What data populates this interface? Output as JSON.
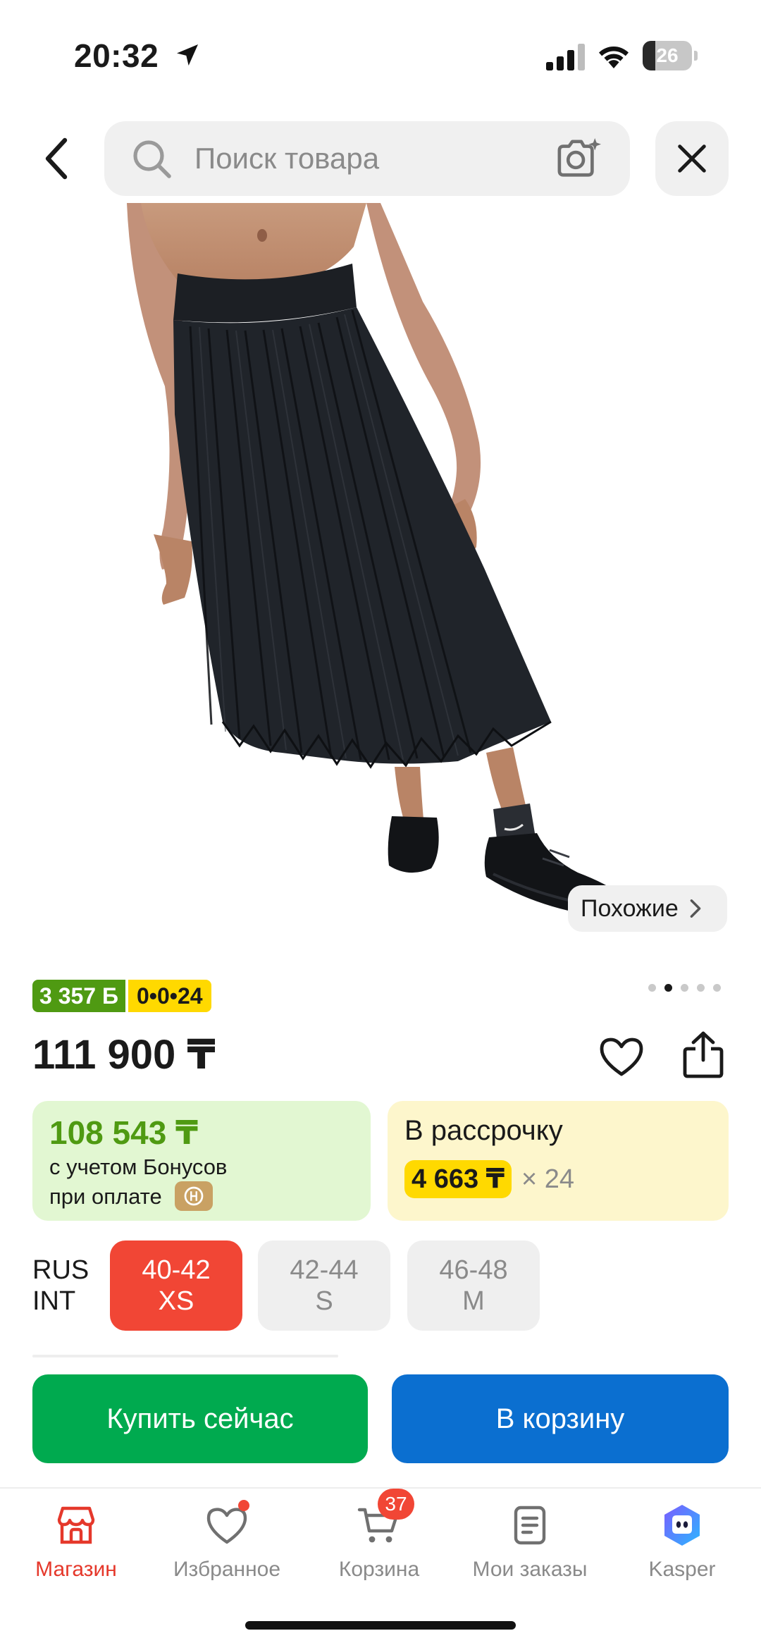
{
  "status_bar": {
    "time": "20:32",
    "battery": "26",
    "battery_level": 0.26
  },
  "search": {
    "placeholder": "Поиск товара"
  },
  "gallery": {
    "similar_label": "Похожие",
    "slide_count": 5,
    "active_slide": 2
  },
  "badges": {
    "bonus": "3 357 Б",
    "installment": "0•0•24"
  },
  "product": {
    "price": "111 900 ₸"
  },
  "offers": {
    "bonus_price": "108 543 ₸",
    "bonus_line1": "с учетом Бонусов",
    "bonus_line2": "при оплате",
    "installment_title": "В рассрочку",
    "installment_monthly": "4 663 ₸",
    "installment_times": "× 24"
  },
  "sizes": {
    "system_top": "RUS",
    "system_bottom": "INT",
    "options": [
      {
        "rus": "40-42",
        "int": "XS",
        "selected": true
      },
      {
        "rus": "42-44",
        "int": "S",
        "selected": false
      },
      {
        "rus": "46-48",
        "int": "M",
        "selected": false
      }
    ]
  },
  "actions": {
    "buy_now": "Купить сейчас",
    "add_to_cart": "В корзину"
  },
  "tabbar": {
    "items": [
      {
        "label": "Магазин",
        "icon": "shop-icon",
        "active": true
      },
      {
        "label": "Избранное",
        "icon": "heart-icon"
      },
      {
        "label": "Корзина",
        "icon": "cart-icon",
        "badge": "37"
      },
      {
        "label": "Мои заказы",
        "icon": "orders-icon"
      },
      {
        "label": "Kasper",
        "icon": "kasper-assistant-icon"
      }
    ]
  },
  "colors": {
    "accent_red": "#f14635",
    "bonus_green": "#4f9a12",
    "buy_green": "#00aa4f",
    "cart_blue": "#0b6fd0",
    "installment_yellow": "#ffd900"
  }
}
